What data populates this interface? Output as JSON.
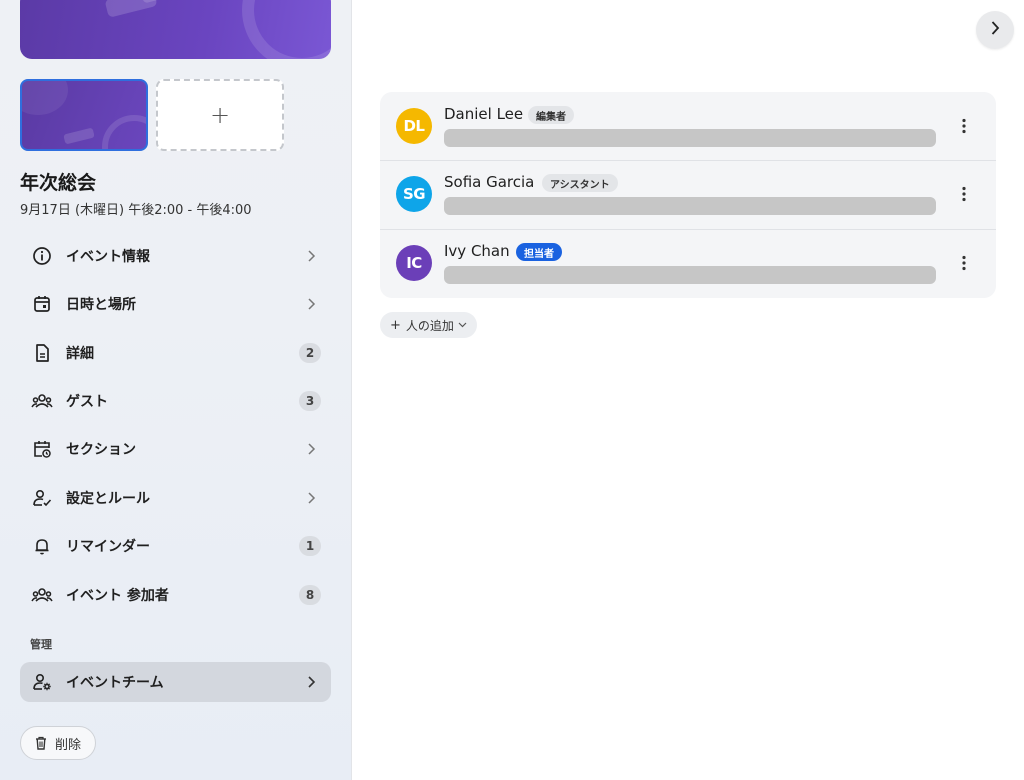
{
  "event": {
    "title": "年次総会",
    "date": "9月17日 (木曜日) 午後2:00 - 午後4:00",
    "add_image_glyph": "+"
  },
  "nav": {
    "items": [
      {
        "label": "イベント情報",
        "icon": "info-icon",
        "type": "chevron"
      },
      {
        "label": "日時と場所",
        "icon": "calendar-icon",
        "type": "chevron"
      },
      {
        "label": "詳細",
        "icon": "document-icon",
        "type": "badge",
        "badge": "2"
      },
      {
        "label": "ゲスト",
        "icon": "group-icon",
        "type": "badge",
        "badge": "3"
      },
      {
        "label": "セクション",
        "icon": "calendar-clock-icon",
        "type": "chevron"
      },
      {
        "label": "設定とルール",
        "icon": "person-check-icon",
        "type": "chevron"
      },
      {
        "label": "リマインダー",
        "icon": "bell-icon",
        "type": "badge",
        "badge": "1"
      },
      {
        "label": "イベント 参加者",
        "icon": "group-icon",
        "type": "badge",
        "badge": "8"
      }
    ],
    "section_label": "管理",
    "active_item": {
      "label": "イベントチーム",
      "icon": "person-gear-icon"
    },
    "delete_label": "削除"
  },
  "team": {
    "members": [
      {
        "initials": "DL",
        "name": "Daniel Lee",
        "role": "編集者",
        "role_style": "gray",
        "avatar_color": "#f5b800"
      },
      {
        "initials": "SG",
        "name": "Sofia Garcia",
        "role": "アシスタント",
        "role_style": "gray",
        "avatar_color": "#0ea5e9"
      },
      {
        "initials": "IC",
        "name": "Ivy Chan",
        "role": "担当者",
        "role_style": "blue",
        "avatar_color": "#6b3fb8"
      }
    ],
    "add_person_label": "人の追加"
  },
  "colors": {
    "accent": "#1a62e0",
    "cover": "#6a45c0"
  }
}
